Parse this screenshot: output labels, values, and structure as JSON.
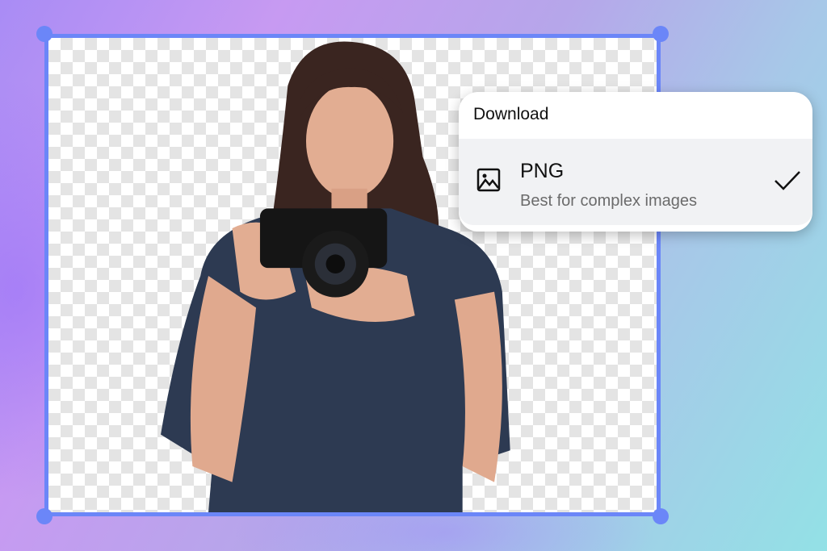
{
  "download_panel": {
    "title": "Download",
    "option": {
      "name": "PNG",
      "description": "Best for complex images",
      "selected": true,
      "icon": "image-icon"
    }
  },
  "colors": {
    "selection": "#6b86f8"
  }
}
